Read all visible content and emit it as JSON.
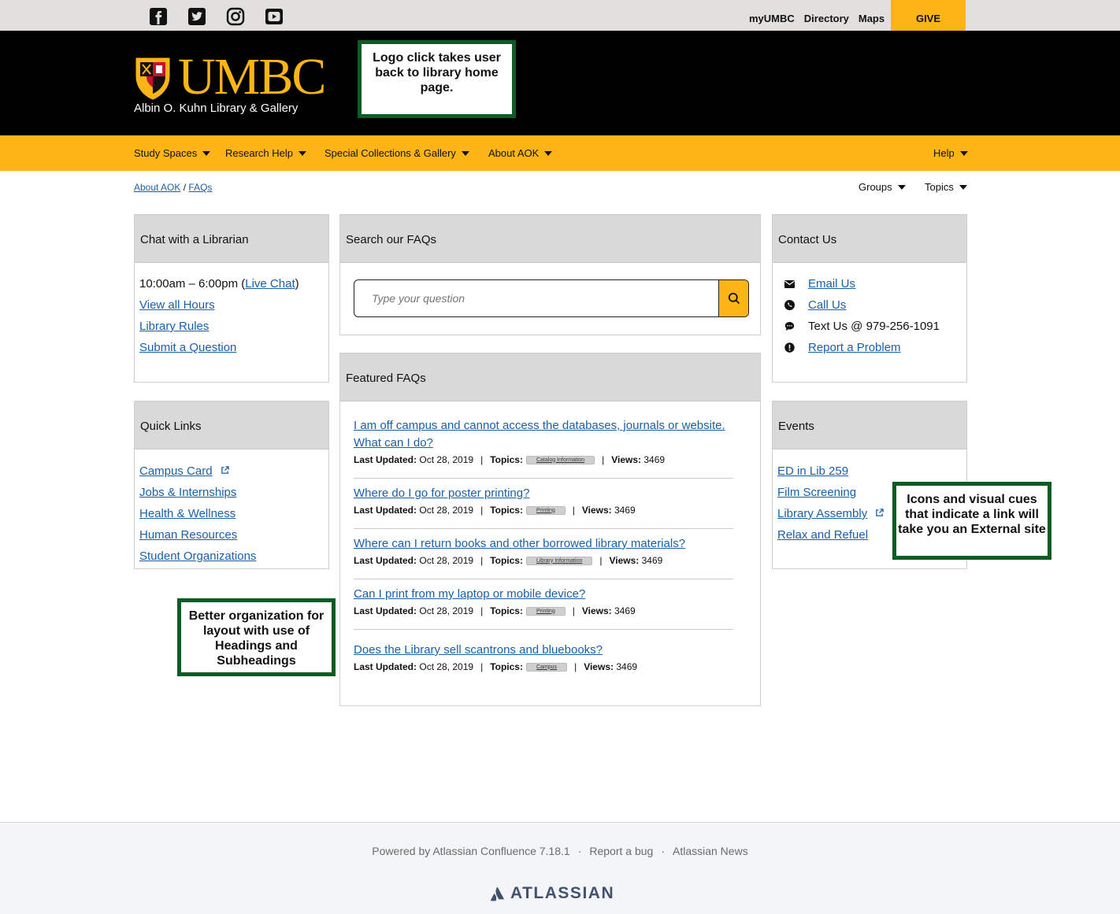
{
  "utility": {
    "social_icons": [
      "facebook-icon",
      "twitter-icon",
      "instagram-icon",
      "youtube-icon"
    ],
    "links": [
      "myUMBC",
      "Directory",
      "Maps"
    ],
    "give": "GIVE"
  },
  "header": {
    "logo_text": "UMBC",
    "subtitle": "Albin O. Kuhn Library & Gallery",
    "annotation": "Logo click takes user back to library home page."
  },
  "nav": {
    "items": [
      "Study Spaces",
      "Research Help",
      "Special Collections & Gallery",
      "About AOK"
    ],
    "help": "Help"
  },
  "breadcrumb": {
    "parent": "About AOK",
    "separator": "/",
    "current": "FAQs"
  },
  "filters": {
    "groups": "Groups",
    "topics": "Topics"
  },
  "chat": {
    "title": "Chat with a Librarian",
    "hours_prefix": "10:00am – 6:00pm (",
    "live_chat": "Live Chat",
    "hours_suffix": ")",
    "links": [
      "View all Hours",
      "Library Rules",
      "Submit a Question"
    ]
  },
  "quick_links": {
    "title": "Quick Links",
    "links": [
      "Campus Card",
      "Jobs & Internships",
      "Health & Wellness",
      "Human Resources",
      "Student Organizations"
    ]
  },
  "search": {
    "title": "Search our FAQs",
    "placeholder": "Type your question"
  },
  "featured": {
    "title": "Featured FAQs",
    "updated_label": "Last Updated:",
    "topics_label": "Topics:",
    "views_label": "Views:",
    "items": [
      {
        "q": "I am off campus and cannot access the databases, journals or website. What can I do?",
        "date": "Oct 28, 2019",
        "topic": "Catalog Information",
        "views": "3469"
      },
      {
        "q": "Where do I go for poster printing?",
        "date": "Oct 28, 2019",
        "topic": "Printing",
        "views": "3469"
      },
      {
        "q": "Where can I return books and other borrowed library materials?",
        "date": "Oct 28, 2019",
        "topic": "Library Information",
        "views": "3469"
      },
      {
        "q": "Can I print from my laptop or mobile device?",
        "date": "Oct 28, 2019",
        "topic": "Printing",
        "views": "3469"
      },
      {
        "q": "Does the Library sell scantrons and bluebooks?",
        "date": "Oct 28, 2019",
        "topic": "Campus",
        "views": "3469"
      }
    ]
  },
  "contact": {
    "title": "Contact Us",
    "email": "Email Us",
    "call": "Call Us",
    "text": "Text Us @ 979-256-1091",
    "report": "Report a Problem"
  },
  "events": {
    "title": "Events",
    "links": [
      "ED in Lib 259",
      "Film Screening",
      "Library Assembly",
      "Relax and Refuel"
    ],
    "annotation": "Icons and visual cues that indicate a link will take you an External site"
  },
  "left_annotation": "Better organization for layout with use of Headings and Subheadings",
  "footer": {
    "powered": "Powered by Atlassian Confluence 7.18.1",
    "dot": "·",
    "report": "Report a bug",
    "news": "Atlassian News",
    "brand": "ATLASSIAN"
  },
  "colors": {
    "gold": "#fdb515",
    "black": "#000000",
    "link": "#1a5fa8",
    "annotation_border": "#0d5c24"
  }
}
